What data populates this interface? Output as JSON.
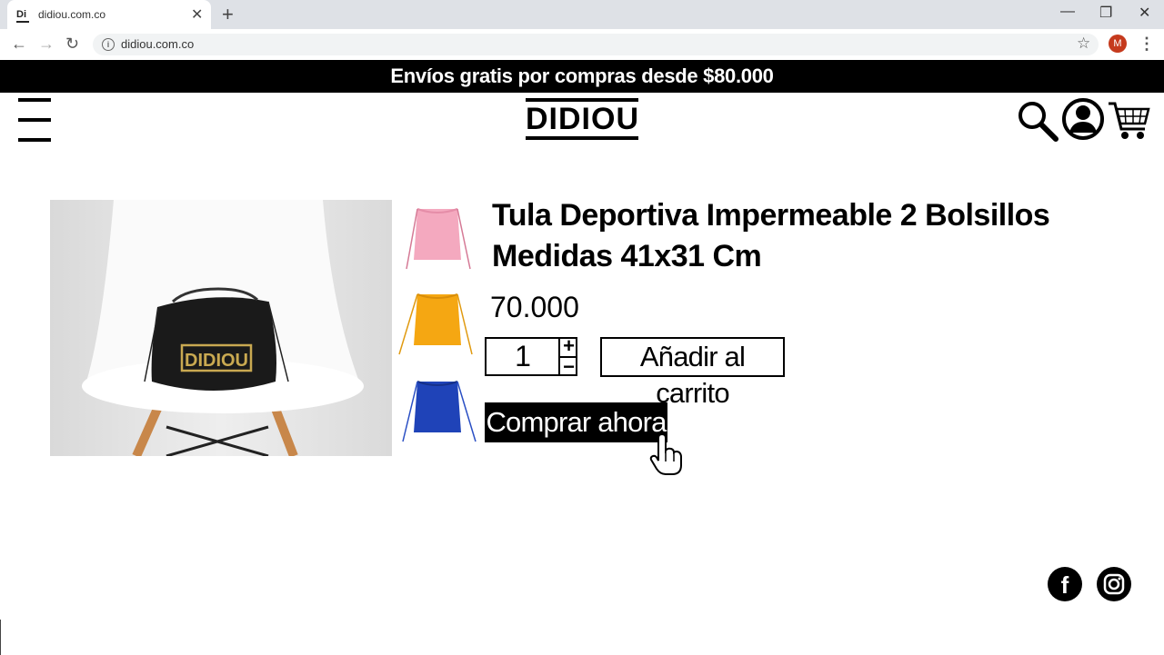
{
  "browser": {
    "tab_favicon": "Di",
    "tab_title": "didiou.com.co",
    "url": "didiou.com.co",
    "profile_initial": "M",
    "info_glyph": "i"
  },
  "page": {
    "promo_text": "Envíos gratis por compras desde $80.000",
    "logo_text": "DIDIOU",
    "product": {
      "title_line1": "Tula Deportiva Impermeable 2 Bolsillos",
      "title_line2": "Medidas 41x31 Cm",
      "price": "70.000",
      "quantity": "1",
      "qty_plus": "+",
      "qty_minus": "−",
      "add_to_cart_label": "Añadir al carrito",
      "buy_now_label": "Comprar ahora",
      "image_brand_text": "DIDIOU",
      "thumbnails": [
        {
          "color_name": "pink",
          "color": "#f4a9bf"
        },
        {
          "color_name": "orange",
          "color": "#f5a712"
        },
        {
          "color_name": "blue",
          "color": "#1f43b8"
        }
      ]
    },
    "social": {
      "facebook_glyph": "f"
    }
  }
}
